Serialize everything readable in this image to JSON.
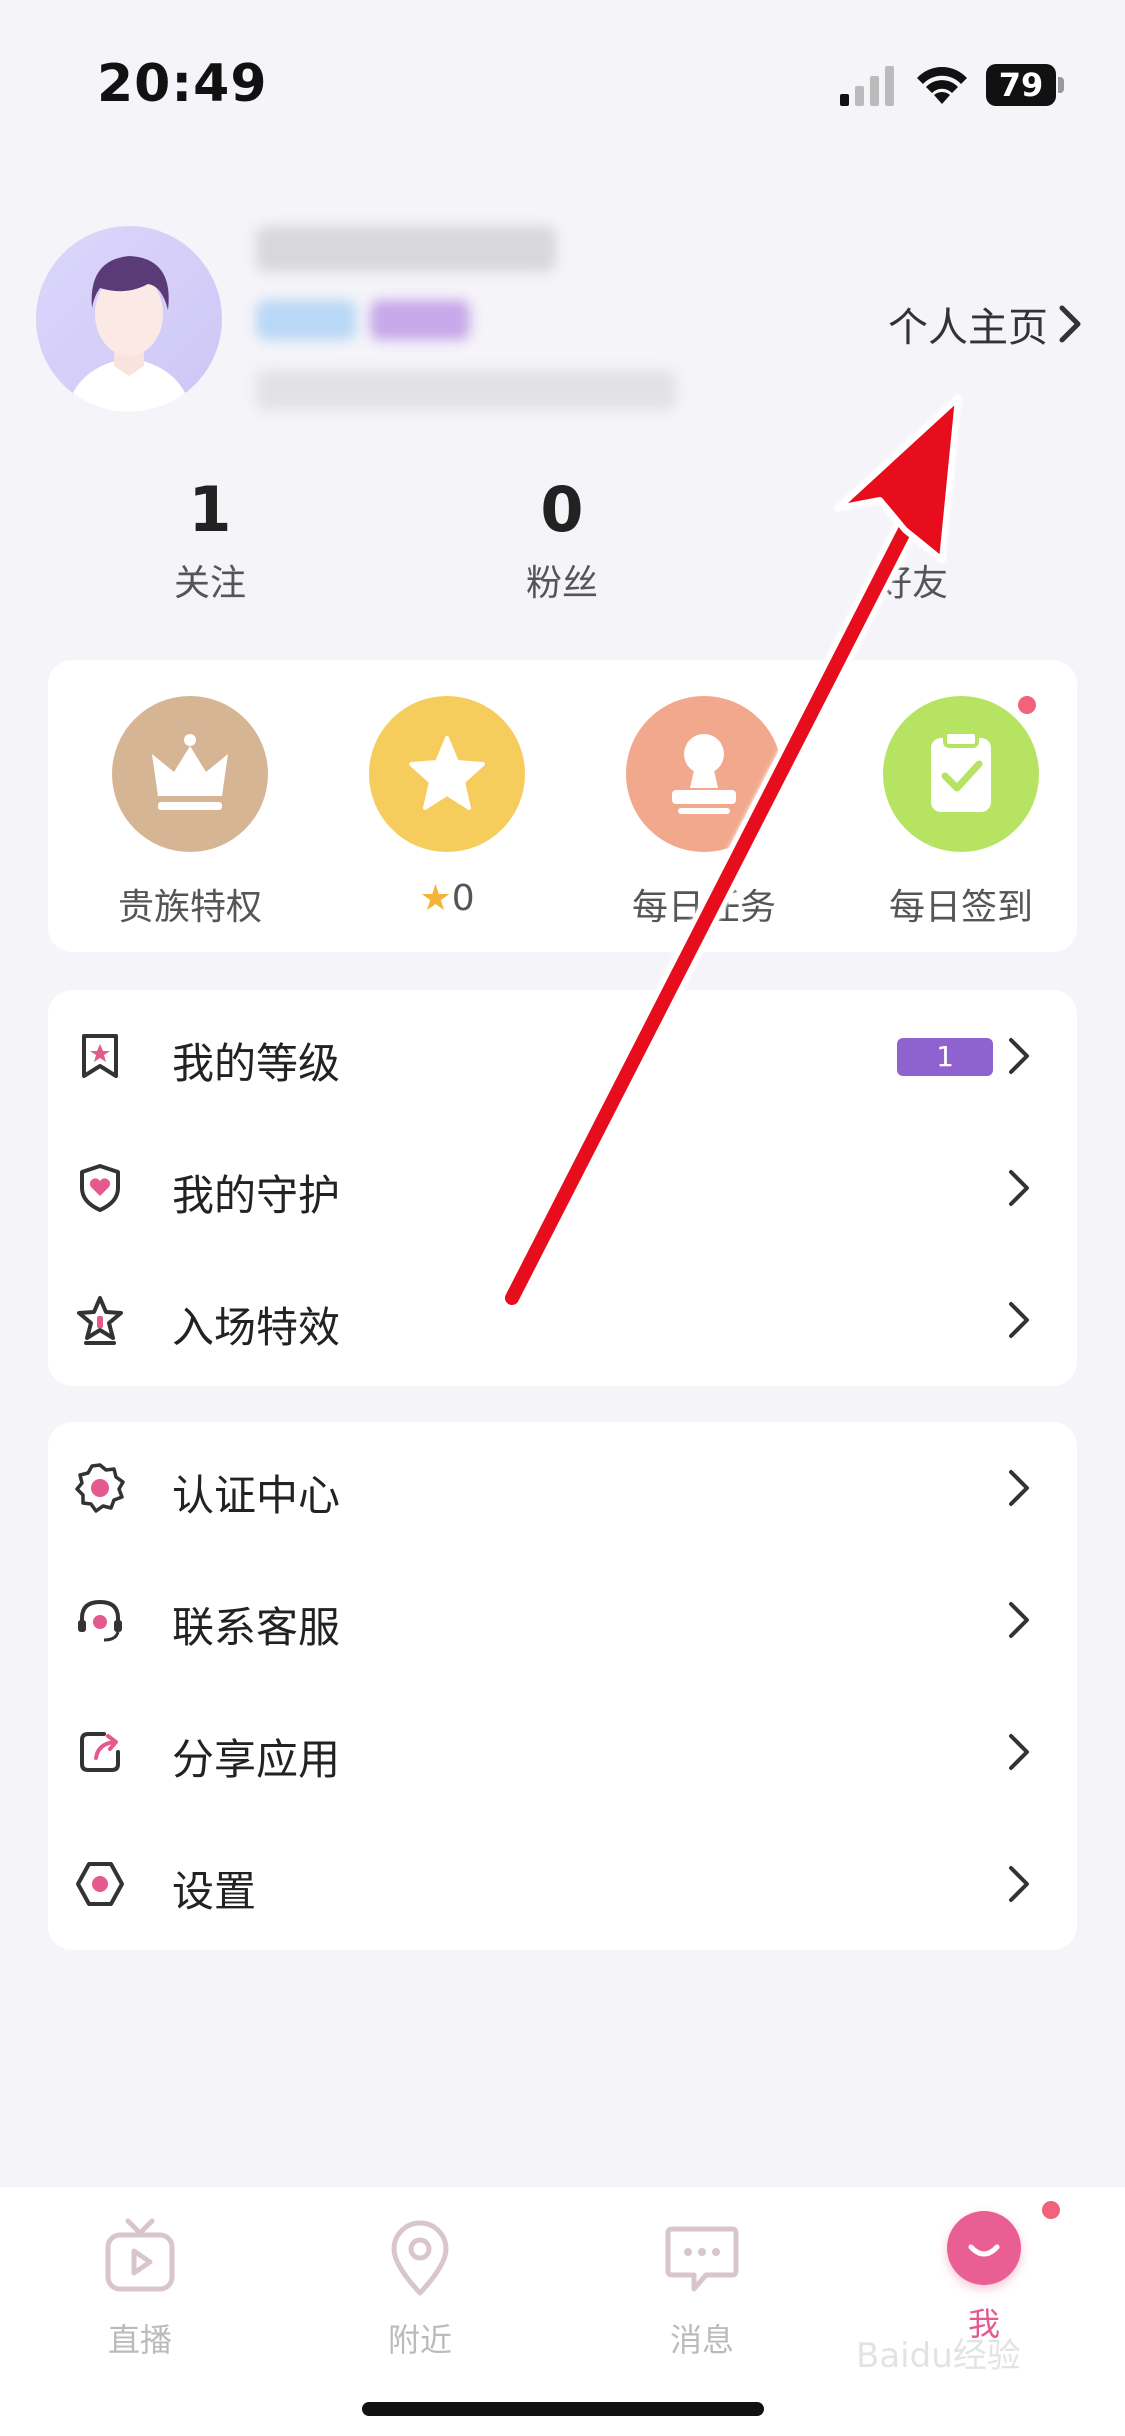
{
  "status_bar": {
    "time": "20:49",
    "battery": "79"
  },
  "profile": {
    "home_link": "个人主页"
  },
  "stats": [
    {
      "value": "1",
      "label": "关注"
    },
    {
      "value": "0",
      "label": "粉丝"
    },
    {
      "value": "",
      "label": "好友"
    }
  ],
  "quick_actions": [
    {
      "label": "贵族特权",
      "icon": "crown-icon",
      "color": "#d6b594"
    },
    {
      "label": "0",
      "icon": "star-icon",
      "color": "#f6cd5c"
    },
    {
      "label": "每日任务",
      "icon": "stamp-icon",
      "color": "#f2a88c"
    },
    {
      "label": "每日签到",
      "icon": "clipboard-check-icon",
      "color": "#b6e462"
    }
  ],
  "menu_group_1": [
    {
      "label": "我的等级",
      "icon": "bookmark-star-icon",
      "badge": "1"
    },
    {
      "label": "我的守护",
      "icon": "shield-heart-icon"
    },
    {
      "label": "入场特效",
      "icon": "star-outline-icon"
    }
  ],
  "menu_group_2": [
    {
      "label": "认证中心",
      "icon": "badge-icon"
    },
    {
      "label": "联系客服",
      "icon": "headset-icon"
    },
    {
      "label": "分享应用",
      "icon": "share-icon"
    },
    {
      "label": "设置",
      "icon": "settings-icon"
    }
  ],
  "tabs": [
    {
      "label": "直播",
      "icon": "tv-icon",
      "active": false
    },
    {
      "label": "附近",
      "icon": "location-icon",
      "active": false
    },
    {
      "label": "消息",
      "icon": "message-icon",
      "active": false
    },
    {
      "label": "我",
      "icon": "smile-icon",
      "active": true
    }
  ],
  "colors": {
    "accent": "#e55a8e",
    "level_badge": "#8e63d0",
    "background": "#f5f4f9",
    "annotation_arrow": "#e8101b"
  },
  "watermark": "Baidu经验"
}
